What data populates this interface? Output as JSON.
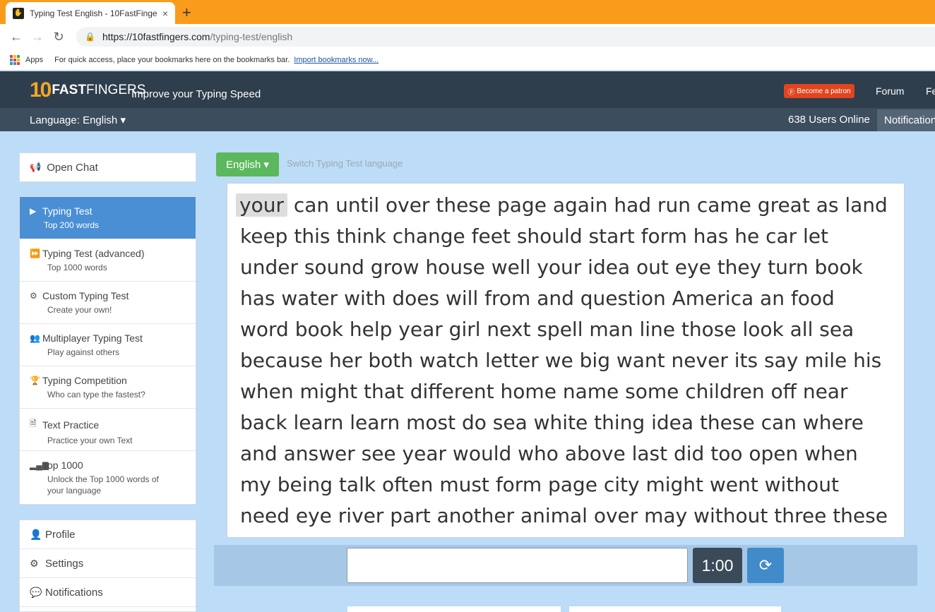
{
  "browser": {
    "tab_title": "Typing Test English - 10FastFinge",
    "tab_close": "×",
    "new_tab": "+",
    "back": "←",
    "forward": "→",
    "reload": "↻",
    "url_host": "https://10fastfingers.com",
    "url_path": "/typing-test/english",
    "apps_label": "Apps",
    "bookmarks_hint": "For quick access, place your bookmarks here on the bookmarks bar.",
    "import_link": "Import bookmarks now..."
  },
  "header": {
    "logo_ten": "10",
    "logo_fast": "FAST",
    "logo_fingers": "FINGERS",
    "tagline": "Improve your Typing Speed",
    "patron_label": "Become a patron",
    "forum": "Forum",
    "next_link": "Fe"
  },
  "subbar": {
    "language": "Language: English ▾",
    "users_online": "638 Users Online",
    "notifications": "Notifications"
  },
  "sidebar": {
    "chat": "Open Chat",
    "menu": [
      {
        "title": "Typing Test",
        "sub": "Top 200 words"
      },
      {
        "title": "Typing Test (advanced)",
        "sub": "Top 1000 words"
      },
      {
        "title": "Custom Typing Test",
        "sub": "Create your own!"
      },
      {
        "title": "Multiplayer Typing Test",
        "sub": "Play against others"
      },
      {
        "title": "Typing Competition",
        "sub": "Who can type the fastest?"
      },
      {
        "title": "Text Practice",
        "sub": "Practice your own Text"
      },
      {
        "title": "Top 1000",
        "sub": "Unlock the Top 1000 words of your language"
      }
    ],
    "profile": [
      "Profile",
      "Settings",
      "Notifications"
    ]
  },
  "main": {
    "lang_button": "English ▾",
    "lang_hint": "Switch Typing Test language",
    "current_word": "your",
    "lines": [
      " can until over these page again had run came great as land",
      "keep this think change feet should start form has he car let",
      "under sound grow house well your idea out eye they turn book",
      "has water with does will from and question America an food",
      "word book help year girl next spell man line those look all sea",
      "because her both watch letter we big want never its say mile his",
      "when might that different home name some children off near",
      "back learn learn most do sea white thing idea these can where",
      "and answer see year would who above last did too open when",
      "my being talk often must form page city might went without",
      "need eye river part another animal over may without three these"
    ],
    "input_value": "",
    "timer": "1:00",
    "reload_icon": "⟳"
  }
}
